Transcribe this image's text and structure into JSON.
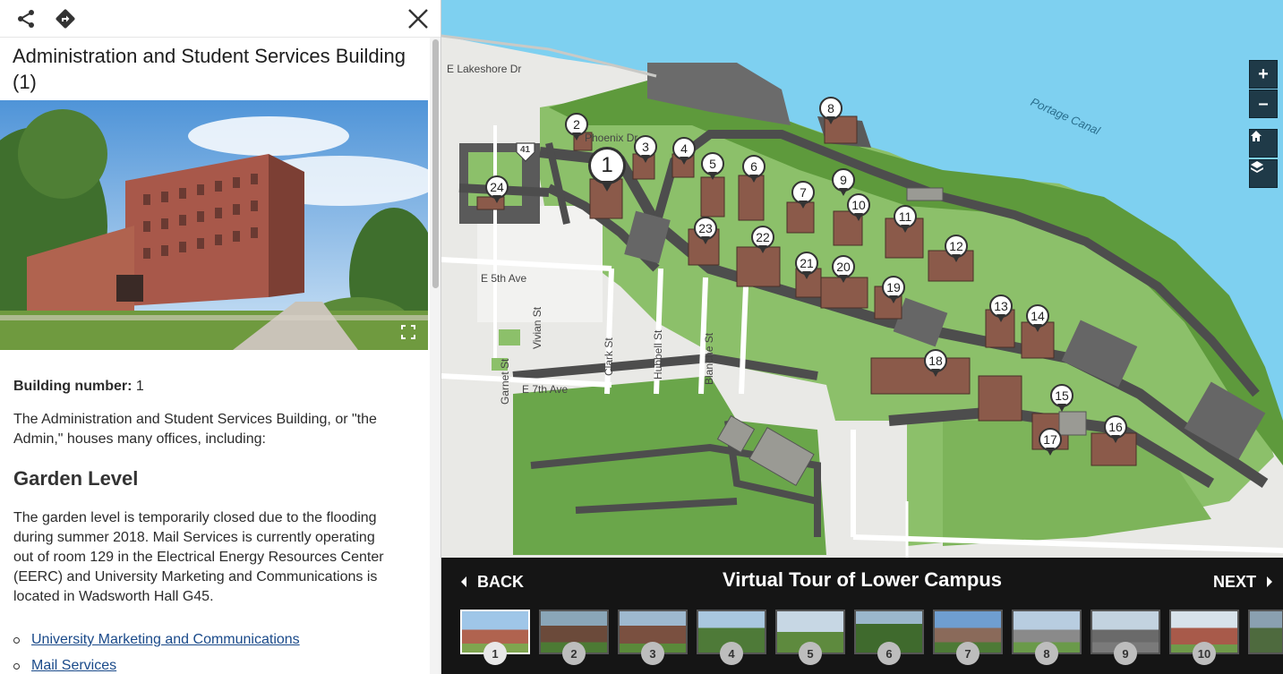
{
  "panel": {
    "title": "Administration and Student Services Building (1)",
    "building_number_label": "Building number:",
    "building_number": "1",
    "intro": "The Administration and Student Services Building, or \"the Admin,\" houses many offices, including:",
    "garden_heading": "Garden Level",
    "garden_text": "The garden level is temporarily closed due to the flooding during summer 2018. Mail Services is currently operating out of room 129 in the Electrical Energy Resources Center (EERC) and University Marketing and Communications is located in Wadsworth Hall G45.",
    "links": [
      "University Marketing and Communications",
      "Mail Services"
    ],
    "icons": {
      "share": "share-icon",
      "directions": "directions-icon",
      "close": "close-icon",
      "expand": "expand-icon"
    }
  },
  "map": {
    "streets": {
      "lakeshore": "E Lakeshore Dr",
      "fifth": "E 5th Ave",
      "seventh": "E 7th Ave",
      "vivian": "Vivian St",
      "clark": "Clark St",
      "hubbell": "Hubbell St",
      "blanche": "Blanche St",
      "garnet": "Garnet St",
      "phoenix": "Phoenix Dr",
      "highway": "41"
    },
    "water_label": "Portage Canal",
    "controls": {
      "zoom_in": "+",
      "zoom_out": "–"
    },
    "markers": [
      "1",
      "2",
      "3",
      "4",
      "5",
      "6",
      "7",
      "8",
      "9",
      "10",
      "11",
      "12",
      "13",
      "14",
      "15",
      "16",
      "17",
      "18",
      "19",
      "20",
      "21",
      "22",
      "23",
      "24"
    ],
    "colors": {
      "water": "#7ed0f0",
      "grass": "#8cc06a",
      "road": "#4d4d4d",
      "land": "#e9e9e6"
    }
  },
  "tour": {
    "back": "BACK",
    "next": "NEXT",
    "title": "Virtual Tour of Lower Campus",
    "thumbs": [
      "1",
      "2",
      "3",
      "4",
      "5",
      "6",
      "7",
      "8",
      "9",
      "10"
    ]
  }
}
